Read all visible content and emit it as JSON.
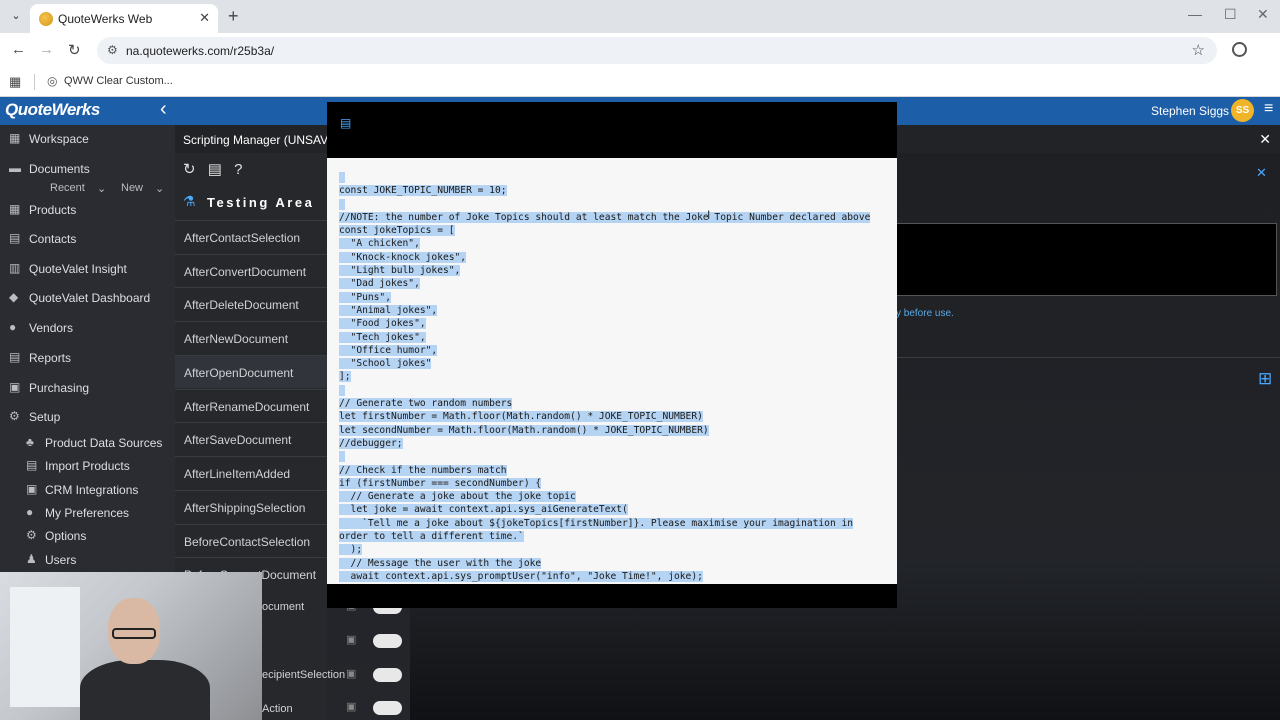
{
  "browser": {
    "tab_title": "QuoteWerks Web",
    "tab_close": "✕",
    "new_tab": "+",
    "url": "na.quotewerks.com/r25b3a/",
    "bookmark_label": "QWW Clear Custom...",
    "window_min": "—",
    "window_max": "☐",
    "window_close": "✕"
  },
  "header": {
    "logo": "QuoteWerks",
    "user_name": "Stephen Siggs",
    "avatar_initials": "SS"
  },
  "sidebar": {
    "items": [
      {
        "icon": "dashboard-icon",
        "glyph": "▦",
        "label": "Workspace"
      },
      {
        "icon": "folder-icon",
        "glyph": "▬",
        "label": "Documents"
      },
      {
        "icon": "products-icon",
        "glyph": "▦",
        "label": "Products"
      },
      {
        "icon": "contacts-icon",
        "glyph": "▤",
        "label": "Contacts"
      },
      {
        "icon": "chart-icon",
        "glyph": "▥",
        "label": "QuoteValet Insight"
      },
      {
        "icon": "gem-icon",
        "glyph": "◆",
        "label": "QuoteValet Dashboard"
      },
      {
        "icon": "vendors-icon",
        "glyph": "●",
        "label": "Vendors"
      },
      {
        "icon": "reports-icon",
        "glyph": "▤",
        "label": "Reports"
      },
      {
        "icon": "purchasing-icon",
        "glyph": "▣",
        "label": "Purchasing"
      },
      {
        "icon": "gear-icon",
        "glyph": "⚙",
        "label": "Setup"
      }
    ],
    "recent_label": "Recent",
    "new_label": "New",
    "setup_items": [
      {
        "icon": "sitemap-icon",
        "glyph": "♣",
        "label": "Product Data Sources"
      },
      {
        "icon": "import-icon",
        "glyph": "▤",
        "label": "Import Products"
      },
      {
        "icon": "crm-icon",
        "glyph": "▣",
        "label": "CRM Integrations"
      },
      {
        "icon": "user-circle-icon",
        "glyph": "●",
        "label": "My Preferences"
      },
      {
        "icon": "cog-icon",
        "glyph": "⚙",
        "label": "Options"
      },
      {
        "icon": "users-icon",
        "glyph": "♟",
        "label": "Users"
      }
    ]
  },
  "scripting": {
    "title": "Scripting Manager (UNSAVE",
    "testing_area_label": "Testing Area",
    "events": [
      "AfterContactSelection",
      "AfterConvertDocument",
      "AfterDeleteDocument",
      "AfterNewDocument",
      "AfterOpenDocument",
      "AfterRenameDocument",
      "AfterSaveDocument",
      "AfterLineItemAdded",
      "AfterShippingSelection",
      "BeforeContactSelection",
      "BeforeConvertDocument"
    ],
    "partial_events": [
      "ocument",
      "ecipientSelection",
      "Action"
    ],
    "note_text": "y before use."
  },
  "modal": {
    "code_lines": [
      "",
      "const JOKE_TOPIC_NUMBER = 10;",
      "",
      "//NOTE: the number of Joke Topics should at least match the Joke Topic Number declared above",
      "const jokeTopics = [",
      "  \"A chicken\",",
      "  \"Knock-knock jokes\",",
      "  \"Light bulb jokes\",",
      "  \"Dad jokes\",",
      "  \"Puns\",",
      "  \"Animal jokes\",",
      "  \"Food jokes\",",
      "  \"Tech jokes\",",
      "  \"Office humor\",",
      "  \"School jokes\"",
      "];",
      "",
      "// Generate two random numbers",
      "let firstNumber = Math.floor(Math.random() * JOKE_TOPIC_NUMBER)",
      "let secondNumber = Math.floor(Math.random() * JOKE_TOPIC_NUMBER)",
      "//debugger;",
      "",
      "// Check if the numbers match",
      "if (firstNumber === secondNumber) {",
      "  // Generate a joke about the joke topic",
      "  let joke = await context.api.sys_aiGenerateText(",
      "    `Tell me a joke about ${jokeTopics[firstNumber]}. Please maximise your imagination in",
      "order to tell a different time.`",
      "  );",
      "  // Message the user with the joke",
      "  await context.api.sys_promptUser(\"info\", \"Joke Time!\", joke);",
      "}"
    ]
  }
}
